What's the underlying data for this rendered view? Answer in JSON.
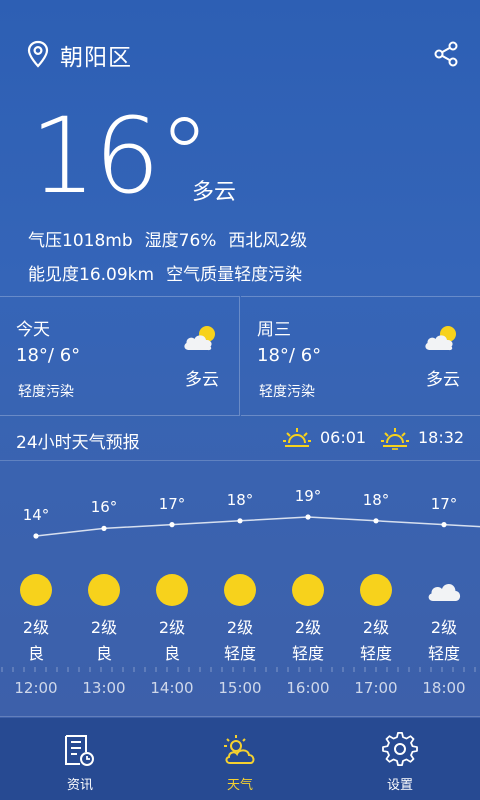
{
  "header": {
    "city": "朝阳区",
    "location_icon": "location-pin-icon",
    "share_icon": "share-icon"
  },
  "current": {
    "temperature": "16°",
    "condition": "多云",
    "details_line1": [
      "气压1018mb",
      "湿度76%",
      "西北风2级"
    ],
    "details_line2": [
      "能见度16.09km",
      "空气质量轻度污染"
    ]
  },
  "days": [
    {
      "name": "今天",
      "range": "18°/ 6°",
      "aqi": "轻度污染",
      "condition": "多云",
      "icon": "partly-cloudy-icon"
    },
    {
      "name": "周三",
      "range": "18°/ 6°",
      "aqi": "轻度污染",
      "condition": "多云",
      "icon": "partly-cloudy-icon"
    }
  ],
  "forecast24": {
    "title": "24小时天气预报",
    "sunrise": "06:01",
    "sunset": "18:32",
    "hours": [
      {
        "time": "12:00",
        "temp": "14°",
        "temp_value": 14,
        "icon": "sun-icon",
        "wind": "2级",
        "aqi": "良"
      },
      {
        "time": "13:00",
        "temp": "16°",
        "temp_value": 16,
        "icon": "sun-icon",
        "wind": "2级",
        "aqi": "良"
      },
      {
        "time": "14:00",
        "temp": "17°",
        "temp_value": 17,
        "icon": "sun-icon",
        "wind": "2级",
        "aqi": "良"
      },
      {
        "time": "15:00",
        "temp": "18°",
        "temp_value": 18,
        "icon": "sun-icon",
        "wind": "2级",
        "aqi": "轻度"
      },
      {
        "time": "16:00",
        "temp": "19°",
        "temp_value": 19,
        "icon": "sun-icon",
        "wind": "2级",
        "aqi": "轻度"
      },
      {
        "time": "17:00",
        "temp": "18°",
        "temp_value": 18,
        "icon": "sun-icon",
        "wind": "2级",
        "aqi": "轻度"
      },
      {
        "time": "18:00",
        "temp": "17°",
        "temp_value": 17,
        "icon": "cloud-icon",
        "wind": "2级",
        "aqi": "轻度"
      }
    ]
  },
  "nav": {
    "items": [
      {
        "label": "资讯",
        "icon": "news-icon",
        "active": false
      },
      {
        "label": "天气",
        "icon": "weather-icon",
        "active": true
      },
      {
        "label": "设置",
        "icon": "gear-icon",
        "active": false
      }
    ]
  },
  "colors": {
    "accent": "#f5d130",
    "sun": "#f7d21c",
    "nav_bg": "#274a92"
  }
}
